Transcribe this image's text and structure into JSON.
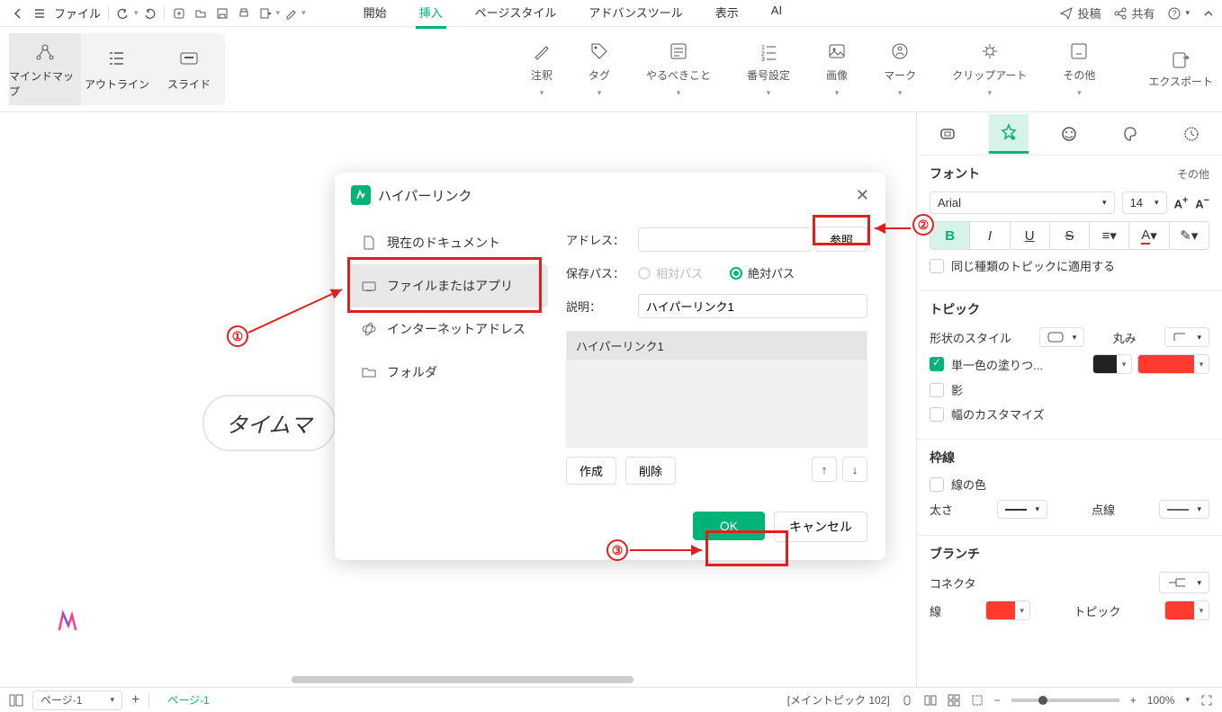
{
  "top": {
    "file_label": "ファイル",
    "menu": [
      "開始",
      "挿入",
      "ページスタイル",
      "アドバンスツール",
      "表示",
      "AI"
    ],
    "menu_active": 1,
    "post": "投稿",
    "share": "共有"
  },
  "ribbon": {
    "views": [
      "マインドマップ",
      "アウトライン",
      "スライド"
    ],
    "items": [
      "注釈",
      "タグ",
      "やるべきこと",
      "番号設定",
      "画像",
      "マーク",
      "クリップアート",
      "その他"
    ],
    "export": "エクスポート"
  },
  "canvas": {
    "topic_text": "タイムマ"
  },
  "dialog": {
    "title": "ハイパーリンク",
    "tabs": {
      "current_doc": "現在のドキュメント",
      "file_or_app": "ファイルまたはアプリ",
      "internet": "インターネットアドレス",
      "folder": "フォルダ"
    },
    "fields": {
      "address_label": "アドレス：",
      "browse": "参照",
      "save_path_label": "保存パス：",
      "relative": "相対パス",
      "absolute": "絶対パス",
      "description_label": "説明：",
      "description_value": "ハイパーリンク1",
      "link_item": "ハイパーリンク1",
      "create": "作成",
      "delete": "削除"
    },
    "ok": "OK",
    "cancel": "キャンセル"
  },
  "panel": {
    "font": {
      "title": "フォント",
      "other": "その他",
      "family": "Arial",
      "size": "14",
      "apply_same": "同じ種類のトピックに適用する"
    },
    "topic": {
      "title": "トピック",
      "shape_style": "形状のスタイル",
      "roundness": "丸み",
      "fill_single": "単一色の塗りつ...",
      "shadow": "影",
      "width_custom": "幅のカスタマイズ"
    },
    "border": {
      "title": "枠線",
      "line_color": "線の色",
      "thickness": "太さ",
      "dotted": "点線"
    },
    "branch": {
      "title": "ブランチ",
      "connector": "コネクタ",
      "line": "線",
      "topic": "トピック"
    }
  },
  "status": {
    "page_select": "ページ-1",
    "page_tab": "ページ-1",
    "info": "[メイントピック 102]",
    "zoom": "100%"
  },
  "annotations": {
    "n1": "①",
    "n2": "②",
    "n3": "③"
  }
}
